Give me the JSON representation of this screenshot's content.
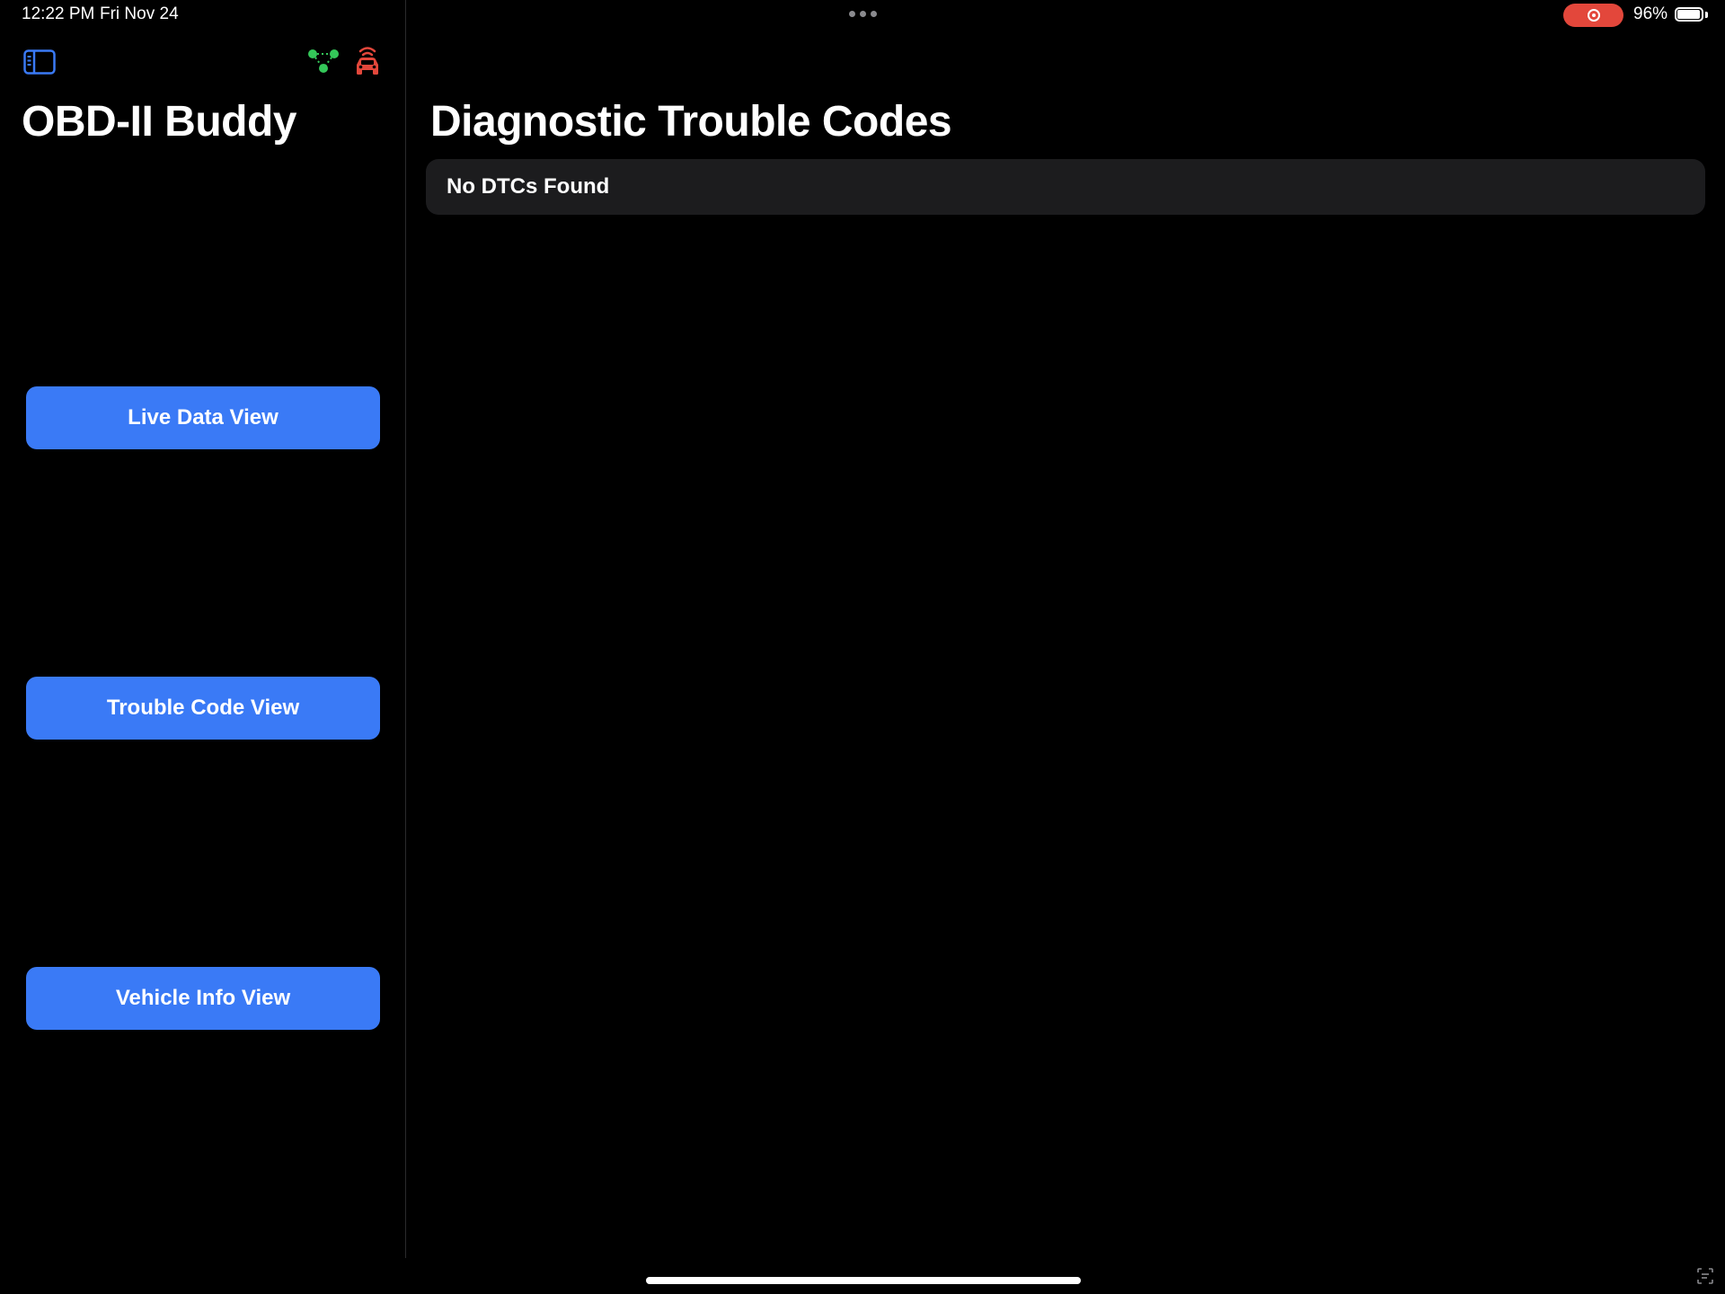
{
  "status_bar": {
    "time": "12:22 PM",
    "date": "Fri Nov 24",
    "battery_percent": "96%",
    "battery_level": 0.96,
    "recording_color": "#e3473b"
  },
  "sidebar": {
    "title": "OBD-II Buddy",
    "toggle_icon": "sidebar-toggle-icon",
    "connection_icon": "network-icon",
    "connection_icon_color": "#34c759",
    "vehicle_icon": "car-signal-icon",
    "vehicle_icon_color": "#e3473b",
    "buttons": [
      {
        "label": "Live Data View"
      },
      {
        "label": "Trouble Code View"
      },
      {
        "label": "Vehicle Info View"
      }
    ],
    "button_color": "#3a7af6"
  },
  "main": {
    "title": "Diagnostic Trouble Codes",
    "dtc_status": "No DTCs Found"
  }
}
